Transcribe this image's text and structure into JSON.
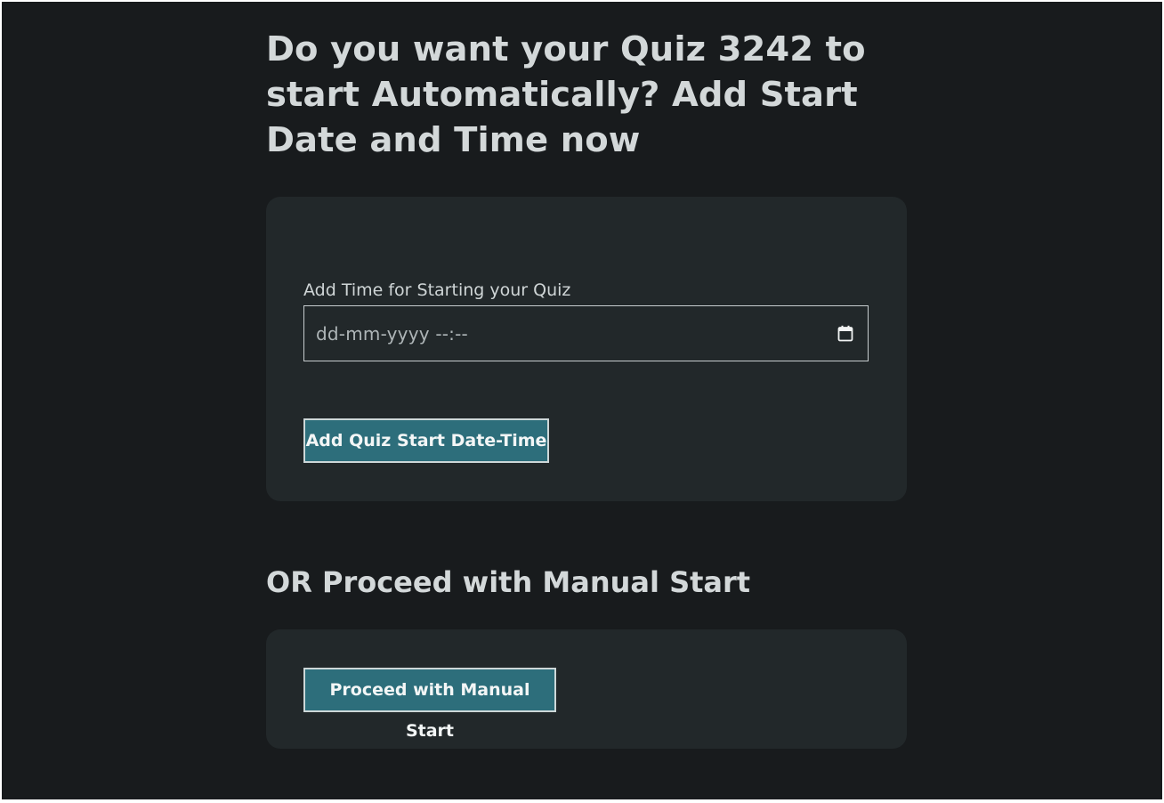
{
  "auto_start": {
    "title": "Do you want your Quiz 3242 to start Automatically? Add Start Date and Time now",
    "field_label": "Add Time for Starting your Quiz",
    "datetime_placeholder": "dd-mm-yyyy --:--",
    "datetime_value": "",
    "submit_label": "Add Quiz Start Date-Time",
    "icon": "calendar-icon"
  },
  "manual_start": {
    "title": "OR Proceed with Manual Start",
    "button_label": "Proceed with Manual Start"
  },
  "colors": {
    "page_background": "#181b1d",
    "card_background": "#22282a",
    "heading_text": "#d3d8d9",
    "button_background": "#2d6e7b",
    "button_border": "#cdd7d8"
  }
}
